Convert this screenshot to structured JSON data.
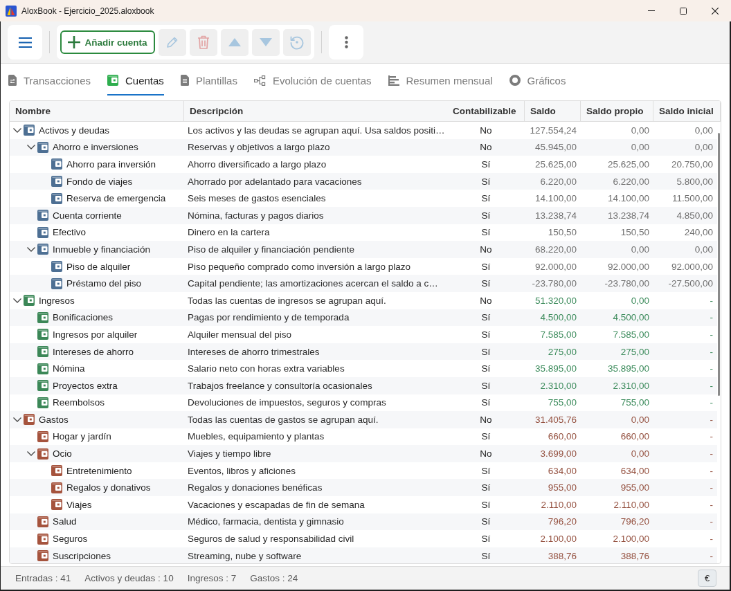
{
  "window": {
    "title": "AloxBook - Ejercicio_2025.aloxbook"
  },
  "toolbar": {
    "add_button": {
      "label": "Añadir cuenta",
      "disabled": false
    },
    "actions": [
      {
        "kind": "edit",
        "disabled": true
      },
      {
        "kind": "delete",
        "disabled": true
      },
      {
        "kind": "move_up",
        "disabled": true
      },
      {
        "kind": "move_down",
        "disabled": true
      },
      {
        "kind": "reset",
        "disabled": true
      }
    ]
  },
  "tabs": [
    {
      "label": "Transacciones",
      "selected": false
    },
    {
      "label": "Cuentas",
      "selected": true
    },
    {
      "label": "Plantillas",
      "selected": false
    },
    {
      "label": "Evolución de cuentas",
      "selected": false
    },
    {
      "label": "Resumen mensual",
      "selected": false
    },
    {
      "label": "Gráficos",
      "selected": false
    }
  ],
  "table": {
    "columns": [
      "Nombre",
      "Descripción",
      "Contabilizable",
      "Saldo",
      "Saldo propio",
      "Saldo inicial"
    ],
    "rows": [
      {
        "name": "Activos y deudas",
        "kind": "asset",
        "expanded": true,
        "description": "Los activos y las deudas se agrupan aquí. Usa saldos positi…",
        "bookable": "No",
        "balance": "127.554,24",
        "own_balance": "0,00",
        "initial_balance": "0,00",
        "children": [
          {
            "name": "Ahorro e inversiones",
            "expanded": true,
            "description": "Reservas y objetivos a largo plazo",
            "bookable": "No",
            "balance": "45.945,00",
            "own_balance": "0,00",
            "initial_balance": "0,00",
            "children": [
              {
                "name": "Ahorro para inversión",
                "description": "Ahorro diversificado a largo plazo",
                "bookable": "Sí",
                "balance": "25.625,00",
                "own_balance": "25.625,00",
                "initial_balance": "20.750,00"
              },
              {
                "name": "Fondo de viajes",
                "description": "Ahorrado por adelantado para vacaciones",
                "bookable": "Sí",
                "balance": "6.220,00",
                "own_balance": "6.220,00",
                "initial_balance": "5.800,00"
              },
              {
                "name": "Reserva de emergencia",
                "description": "Seis meses de gastos esenciales",
                "bookable": "Sí",
                "balance": "14.100,00",
                "own_balance": "14.100,00",
                "initial_balance": "11.500,00"
              }
            ]
          },
          {
            "name": "Cuenta corriente",
            "description": "Nómina, facturas y pagos diarios",
            "bookable": "Sí",
            "balance": "13.238,74",
            "own_balance": "13.238,74",
            "initial_balance": "4.850,00"
          },
          {
            "name": "Efectivo",
            "description": "Dinero en la cartera",
            "bookable": "Sí",
            "balance": "150,50",
            "own_balance": "150,50",
            "initial_balance": "240,00"
          },
          {
            "name": "Inmueble y financiación",
            "expanded": true,
            "description": "Piso de alquiler y financiación pendiente",
            "bookable": "No",
            "balance": "68.220,00",
            "own_balance": "0,00",
            "initial_balance": "0,00",
            "children": [
              {
                "name": "Piso de alquiler",
                "description": "Piso pequeño comprado como inversión a largo plazo",
                "bookable": "Sí",
                "balance": "92.000,00",
                "own_balance": "92.000,00",
                "initial_balance": "92.000,00"
              },
              {
                "name": "Préstamo del piso",
                "description": "Capital pendiente; las amortizaciones acercan el saldo a c…",
                "bookable": "Sí",
                "balance": "-23.780,00",
                "own_balance": "-23.780,00",
                "initial_balance": "-27.500,00"
              }
            ]
          }
        ]
      },
      {
        "name": "Ingresos",
        "kind": "income",
        "expanded": true,
        "description": "Todas las cuentas de ingresos se agrupan aquí.",
        "bookable": "No",
        "balance": "51.320,00",
        "own_balance": "0,00",
        "initial_balance": "-",
        "children": [
          {
            "name": "Bonificaciones",
            "description": "Pagas por rendimiento y de temporada",
            "bookable": "Sí",
            "balance": "4.500,00",
            "own_balance": "4.500,00",
            "initial_balance": "-"
          },
          {
            "name": "Ingresos por alquiler",
            "description": "Alquiler mensual del piso",
            "bookable": "Sí",
            "balance": "7.585,00",
            "own_balance": "7.585,00",
            "initial_balance": "-"
          },
          {
            "name": "Intereses de ahorro",
            "description": "Intereses de ahorro trimestrales",
            "bookable": "Sí",
            "balance": "275,00",
            "own_balance": "275,00",
            "initial_balance": "-"
          },
          {
            "name": "Nómina",
            "description": "Salario neto con horas extra variables",
            "bookable": "Sí",
            "balance": "35.895,00",
            "own_balance": "35.895,00",
            "initial_balance": "-"
          },
          {
            "name": "Proyectos extra",
            "description": "Trabajos freelance y consultoría ocasionales",
            "bookable": "Sí",
            "balance": "2.310,00",
            "own_balance": "2.310,00",
            "initial_balance": "-"
          },
          {
            "name": "Reembolsos",
            "description": "Devoluciones de impuestos, seguros y compras",
            "bookable": "Sí",
            "balance": "755,00",
            "own_balance": "755,00",
            "initial_balance": "-"
          }
        ]
      },
      {
        "name": "Gastos",
        "kind": "expense",
        "expanded": true,
        "description": "Todas las cuentas de gastos se agrupan aquí.",
        "bookable": "No",
        "balance": "31.405,76",
        "own_balance": "0,00",
        "initial_balance": "-",
        "children": [
          {
            "name": "Hogar y jardín",
            "description": "Muebles, equipamiento y plantas",
            "bookable": "Sí",
            "balance": "660,00",
            "own_balance": "660,00",
            "initial_balance": "-"
          },
          {
            "name": "Ocio",
            "expanded": true,
            "description": "Viajes y tiempo libre",
            "bookable": "No",
            "balance": "3.699,00",
            "own_balance": "0,00",
            "initial_balance": "-",
            "children": [
              {
                "name": "Entretenimiento",
                "description": "Eventos, libros y aficiones",
                "bookable": "Sí",
                "balance": "634,00",
                "own_balance": "634,00",
                "initial_balance": "-"
              },
              {
                "name": "Regalos y donativos",
                "description": "Regalos y donaciones benéficas",
                "bookable": "Sí",
                "balance": "955,00",
                "own_balance": "955,00",
                "initial_balance": "-"
              },
              {
                "name": "Viajes",
                "description": "Vacaciones y escapadas de fin de semana",
                "bookable": "Sí",
                "balance": "2.110,00",
                "own_balance": "2.110,00",
                "initial_balance": "-"
              }
            ]
          },
          {
            "name": "Salud",
            "description": "Médico, farmacia, dentista y gimnasio",
            "bookable": "Sí",
            "balance": "796,20",
            "own_balance": "796,20",
            "initial_balance": "-"
          },
          {
            "name": "Seguros",
            "description": "Seguros de salud y responsabilidad civil",
            "bookable": "Sí",
            "balance": "2.100,00",
            "own_balance": "2.100,00",
            "initial_balance": "-"
          },
          {
            "name": "Suscripciones",
            "description": "Streaming, nube y software",
            "bookable": "Sí",
            "balance": "388,76",
            "own_balance": "388,76",
            "initial_balance": "-"
          }
        ]
      }
    ]
  },
  "status_bar": {
    "counts": [
      "Entradas : 41",
      "Activos y deudas : 10",
      "Ingresos : 7",
      "Gastos : 24"
    ],
    "currency_button": "€"
  }
}
